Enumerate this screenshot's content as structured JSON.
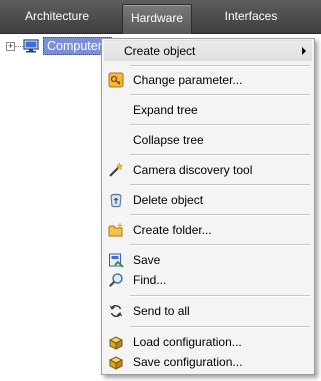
{
  "tabs": [
    {
      "label": "Architecture"
    },
    {
      "label": "Hardware"
    },
    {
      "label": "Interfaces"
    }
  ],
  "tree": {
    "root_label": "Computer",
    "expander_glyph": "+"
  },
  "menu": {
    "items": [
      {
        "label": "Create object",
        "icon": "none",
        "has_submenu": true
      },
      {
        "label": "Change parameter...",
        "icon": "key-icon"
      },
      {
        "label": "Expand tree",
        "icon": "none"
      },
      {
        "label": "Collapse tree",
        "icon": "none"
      },
      {
        "label": "Camera discovery tool",
        "icon": "magic-wand-icon"
      },
      {
        "label": "Delete object",
        "icon": "recycle-bin-icon"
      },
      {
        "label": "Create folder...",
        "icon": "new-folder-icon"
      },
      {
        "label": "Save",
        "icon": "save-icon"
      },
      {
        "label": "Find...",
        "icon": "magnifier-icon"
      },
      {
        "label": "Send to all",
        "icon": "refresh-arrows-icon"
      },
      {
        "label": "Load configuration...",
        "icon": "box-icon"
      },
      {
        "label": "Save configuration...",
        "icon": "box-icon"
      }
    ]
  },
  "colors": {
    "tab_bar": "#4a4a4a",
    "selection": "#7b8fd8",
    "menu_bg": "#f4f4f4"
  }
}
